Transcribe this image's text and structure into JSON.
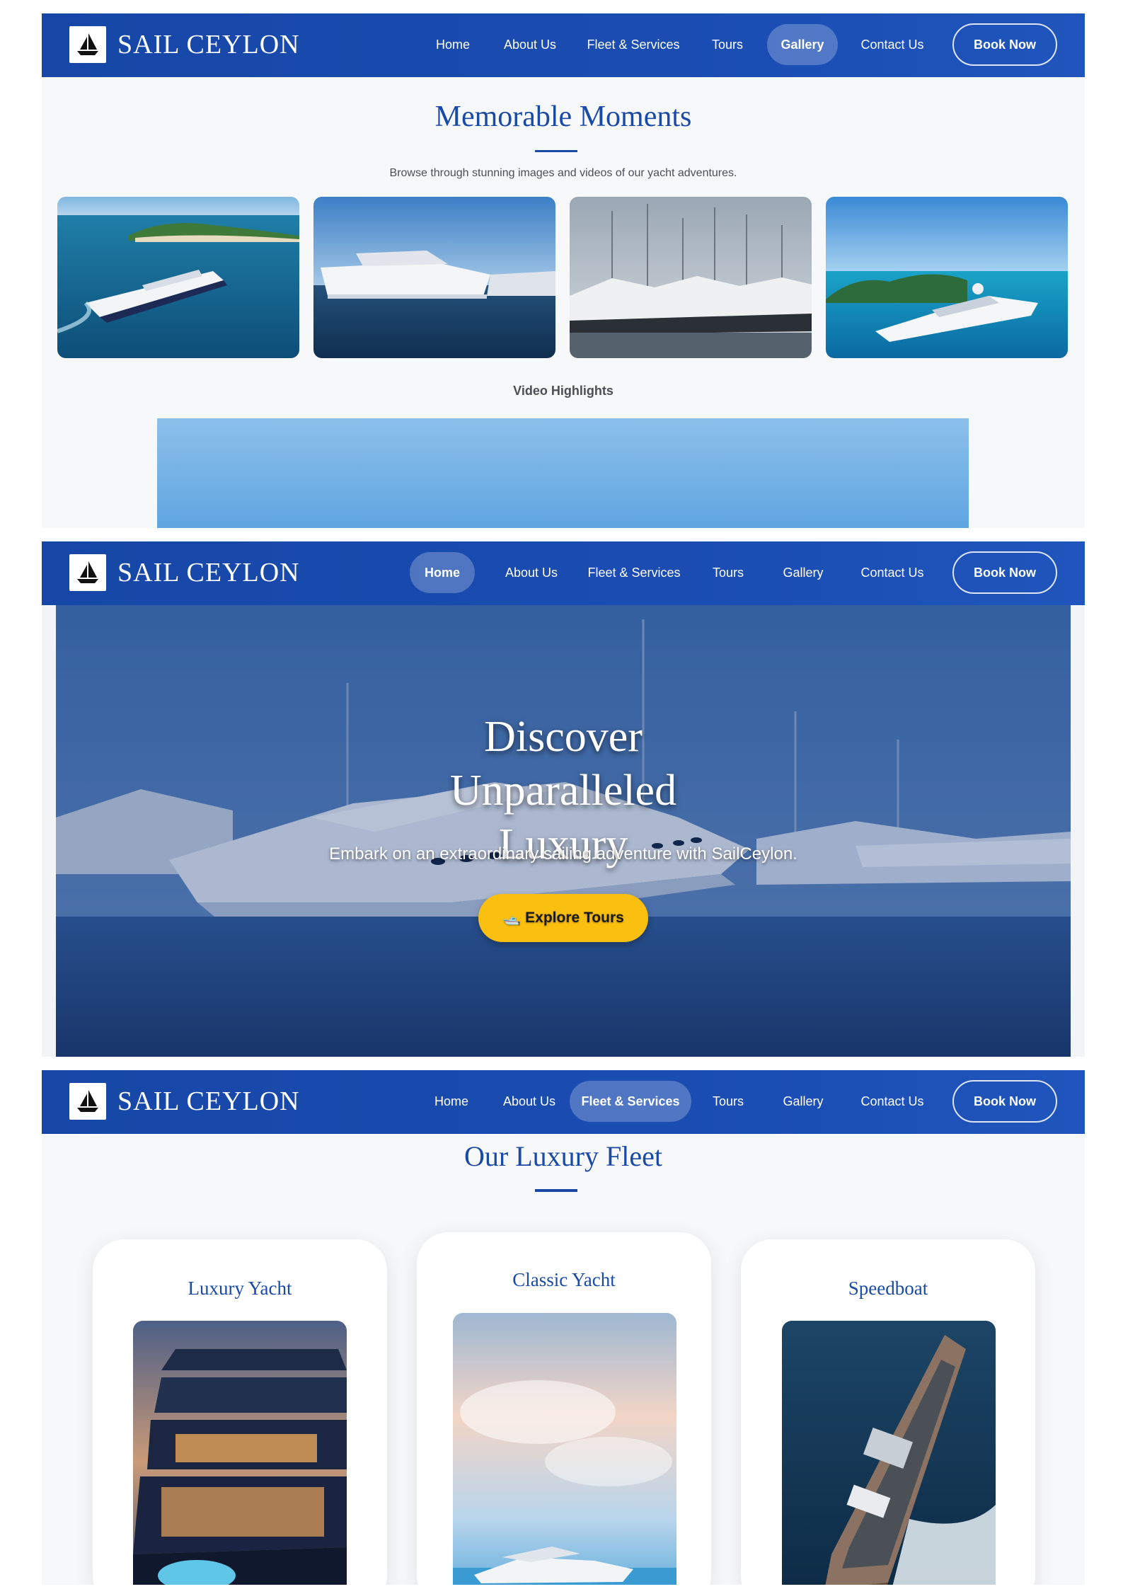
{
  "brand": {
    "name": "SAIL CEYLON",
    "logo_icon": "sailboat-icon"
  },
  "nav": {
    "items": [
      "Home",
      "About Us",
      "Fleet & Services",
      "Tours",
      "Gallery",
      "Contact Us"
    ],
    "book_label": "Book Now"
  },
  "gallery": {
    "active_nav": "Gallery",
    "title": "Memorable Moments",
    "subtitle": "Browse through stunning images and videos of our yacht adventures.",
    "video_title": "Video Highlights"
  },
  "hero": {
    "active_nav": "Home",
    "title": "Discover Unparalleled Luxury",
    "subtitle": "Embark on an extraordinary sailing adventure with SailCeylon.",
    "button_icon": "🛥️",
    "button_label": "Explore Tours"
  },
  "fleet": {
    "active_nav": "Fleet & Services",
    "title": "Our Luxury Fleet",
    "cards": [
      {
        "title": "Luxury Yacht"
      },
      {
        "title": "Classic Yacht"
      },
      {
        "title": "Speedboat"
      }
    ]
  },
  "colors": {
    "primary": "#1a4aa6",
    "accent": "#fbbf0f",
    "navbar": "#1a4cb2"
  }
}
